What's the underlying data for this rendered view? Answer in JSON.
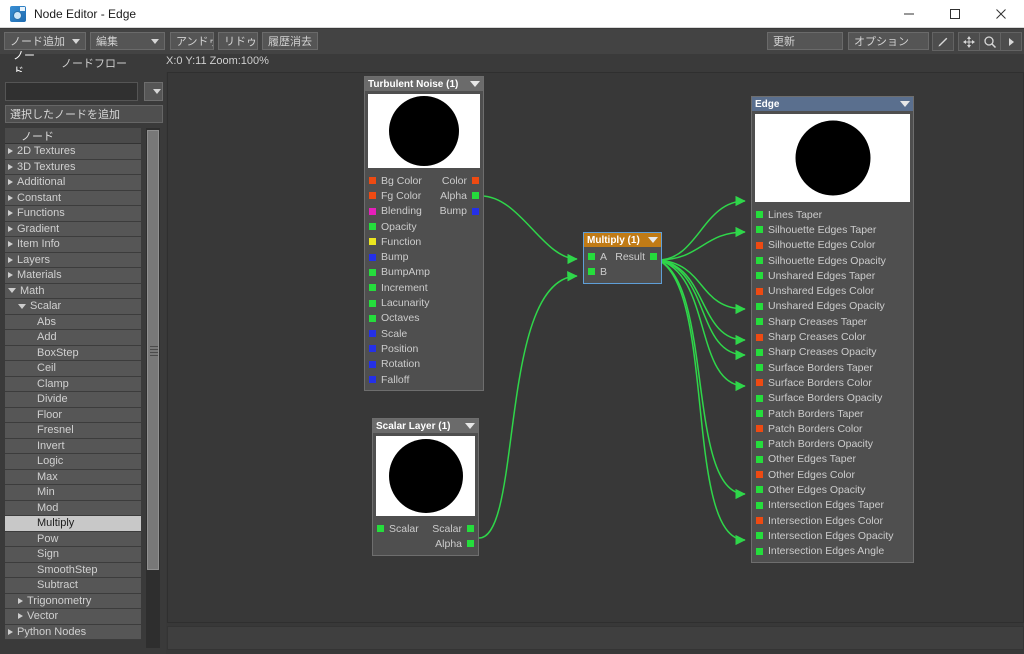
{
  "window": {
    "title": "Node Editor - Edge",
    "icon": "node-editor-icon",
    "minimize": "minimize-icon",
    "maximize": "maximize-icon",
    "close": "close-icon"
  },
  "toolbar": {
    "add_node": "ノード追加",
    "edit": "編集",
    "undo": "アンドゥ",
    "redo": "リドゥ",
    "clear_history": "履歴消去",
    "update": "更新",
    "options": "オプション",
    "pen_icon": "pen-icon",
    "pan_icon": "pan-icon",
    "zoom_icon": "magnifier-icon",
    "more_icon": "play-arrow-icon"
  },
  "tabs": [
    {
      "label": "ノード",
      "active": true
    },
    {
      "label": "ノードフロー",
      "active": false
    }
  ],
  "status": {
    "coords": "X:0 Y:11 Zoom:100%"
  },
  "sidebar": {
    "search_value": "",
    "search_placeholder": "",
    "dropdown_icon": "chevron-down-icon",
    "add_selected_node": "選択したノードを追加",
    "tree_header": "ノード",
    "tree": [
      {
        "label": "2D Textures",
        "depth": 0,
        "arrow": "collapsed",
        "selected": false
      },
      {
        "label": "3D Textures",
        "depth": 0,
        "arrow": "collapsed",
        "selected": false
      },
      {
        "label": "Additional",
        "depth": 0,
        "arrow": "collapsed",
        "selected": false
      },
      {
        "label": "Constant",
        "depth": 0,
        "arrow": "collapsed",
        "selected": false
      },
      {
        "label": "Functions",
        "depth": 0,
        "arrow": "collapsed",
        "selected": false
      },
      {
        "label": "Gradient",
        "depth": 0,
        "arrow": "collapsed",
        "selected": false
      },
      {
        "label": "Item Info",
        "depth": 0,
        "arrow": "collapsed",
        "selected": false
      },
      {
        "label": "Layers",
        "depth": 0,
        "arrow": "collapsed",
        "selected": false
      },
      {
        "label": "Materials",
        "depth": 0,
        "arrow": "collapsed",
        "selected": false
      },
      {
        "label": "Math",
        "depth": 0,
        "arrow": "expanded",
        "selected": false
      },
      {
        "label": "Scalar",
        "depth": 1,
        "arrow": "expanded",
        "selected": false
      },
      {
        "label": "Abs",
        "depth": 2,
        "arrow": "none",
        "selected": false
      },
      {
        "label": "Add",
        "depth": 2,
        "arrow": "none",
        "selected": false
      },
      {
        "label": "BoxStep",
        "depth": 2,
        "arrow": "none",
        "selected": false
      },
      {
        "label": "Ceil",
        "depth": 2,
        "arrow": "none",
        "selected": false
      },
      {
        "label": "Clamp",
        "depth": 2,
        "arrow": "none",
        "selected": false
      },
      {
        "label": "Divide",
        "depth": 2,
        "arrow": "none",
        "selected": false
      },
      {
        "label": "Floor",
        "depth": 2,
        "arrow": "none",
        "selected": false
      },
      {
        "label": "Fresnel",
        "depth": 2,
        "arrow": "none",
        "selected": false
      },
      {
        "label": "Invert",
        "depth": 2,
        "arrow": "none",
        "selected": false
      },
      {
        "label": "Logic",
        "depth": 2,
        "arrow": "none",
        "selected": false
      },
      {
        "label": "Max",
        "depth": 2,
        "arrow": "none",
        "selected": false
      },
      {
        "label": "Min",
        "depth": 2,
        "arrow": "none",
        "selected": false
      },
      {
        "label": "Mod",
        "depth": 2,
        "arrow": "none",
        "selected": false
      },
      {
        "label": "Multiply",
        "depth": 2,
        "arrow": "none",
        "selected": true
      },
      {
        "label": "Pow",
        "depth": 2,
        "arrow": "none",
        "selected": false
      },
      {
        "label": "Sign",
        "depth": 2,
        "arrow": "none",
        "selected": false
      },
      {
        "label": "SmoothStep",
        "depth": 2,
        "arrow": "none",
        "selected": false
      },
      {
        "label": "Subtract",
        "depth": 2,
        "arrow": "none",
        "selected": false
      },
      {
        "label": "Trigonometry",
        "depth": 1,
        "arrow": "collapsed",
        "selected": false
      },
      {
        "label": "Vector",
        "depth": 1,
        "arrow": "collapsed",
        "selected": false
      },
      {
        "label": "Python Nodes",
        "depth": 0,
        "arrow": "collapsed",
        "selected": false
      }
    ]
  },
  "nodes": {
    "turbulent_noise": {
      "title": "Turbulent Noise (1)",
      "header_color": "#6b6b6b",
      "inputs": [
        {
          "label": "Bg Color",
          "color": "r"
        },
        {
          "label": "Fg Color",
          "color": "r"
        },
        {
          "label": "Blending",
          "color": "m"
        },
        {
          "label": "Opacity",
          "color": "g"
        },
        {
          "label": "Function",
          "color": "y"
        },
        {
          "label": "Bump",
          "color": "b"
        },
        {
          "label": "BumpAmp",
          "color": "g"
        },
        {
          "label": "Increment",
          "color": "g"
        },
        {
          "label": "Lacunarity",
          "color": "g"
        },
        {
          "label": "Octaves",
          "color": "g"
        },
        {
          "label": "Scale",
          "color": "b"
        },
        {
          "label": "Position",
          "color": "b"
        },
        {
          "label": "Rotation",
          "color": "b"
        },
        {
          "label": "Falloff",
          "color": "b"
        }
      ],
      "outputs": [
        {
          "label": "Color",
          "color": "r"
        },
        {
          "label": "Alpha",
          "color": "g"
        },
        {
          "label": "Bump",
          "color": "b"
        }
      ]
    },
    "scalar_layer": {
      "title": "Scalar Layer (1)",
      "header_color": "#6b6b6b",
      "inputs": [
        {
          "label": "Scalar",
          "color": "g"
        }
      ],
      "outputs": [
        {
          "label": "Scalar",
          "color": "g"
        },
        {
          "label": "Alpha",
          "color": "g"
        }
      ]
    },
    "multiply": {
      "title": "Multiply (1)",
      "header_color": "#c07b16",
      "inputs": [
        {
          "label": "A",
          "color": "g"
        },
        {
          "label": "B",
          "color": "g"
        }
      ],
      "outputs": [
        {
          "label": "Result",
          "color": "g"
        }
      ]
    },
    "edge": {
      "title": "Edge",
      "header_color": "#5a6f8e",
      "inputs": [
        {
          "label": "Lines Taper",
          "color": "g",
          "connected": false
        },
        {
          "label": "Silhouette Edges Taper",
          "color": "g",
          "connected": true
        },
        {
          "label": "Silhouette Edges Color",
          "color": "r",
          "connected": false
        },
        {
          "label": "Silhouette Edges Opacity",
          "color": "g",
          "connected": true
        },
        {
          "label": "Unshared Edges Taper",
          "color": "g",
          "connected": false
        },
        {
          "label": "Unshared Edges Color",
          "color": "r",
          "connected": false
        },
        {
          "label": "Unshared Edges Opacity",
          "color": "g",
          "connected": false
        },
        {
          "label": "Sharp Creases Taper",
          "color": "g",
          "connected": true
        },
        {
          "label": "Sharp Creases Color",
          "color": "r",
          "connected": false
        },
        {
          "label": "Sharp Creases Opacity",
          "color": "g",
          "connected": true
        },
        {
          "label": "Surface Borders Taper",
          "color": "g",
          "connected": true
        },
        {
          "label": "Surface Borders Color",
          "color": "r",
          "connected": false
        },
        {
          "label": "Surface Borders Opacity",
          "color": "g",
          "connected": true
        },
        {
          "label": "Patch Borders Taper",
          "color": "g",
          "connected": false
        },
        {
          "label": "Patch Borders Color",
          "color": "r",
          "connected": false
        },
        {
          "label": "Patch Borders Opacity",
          "color": "g",
          "connected": false
        },
        {
          "label": "Other Edges Taper",
          "color": "g",
          "connected": false
        },
        {
          "label": "Other Edges Color",
          "color": "r",
          "connected": false
        },
        {
          "label": "Other Edges Opacity",
          "color": "g",
          "connected": false
        },
        {
          "label": "Intersection Edges Taper",
          "color": "g",
          "connected": true
        },
        {
          "label": "Intersection Edges Color",
          "color": "r",
          "connected": false
        },
        {
          "label": "Intersection Edges Opacity",
          "color": "g",
          "connected": true
        },
        {
          "label": "Intersection Edges Angle",
          "color": "g",
          "connected": false
        }
      ],
      "outputs": []
    }
  },
  "colors": {
    "wire": "#2fd64a",
    "accent": "#3d7fc1",
    "canvas_bg": "#383838",
    "panel_bg": "#3a3a3a"
  }
}
